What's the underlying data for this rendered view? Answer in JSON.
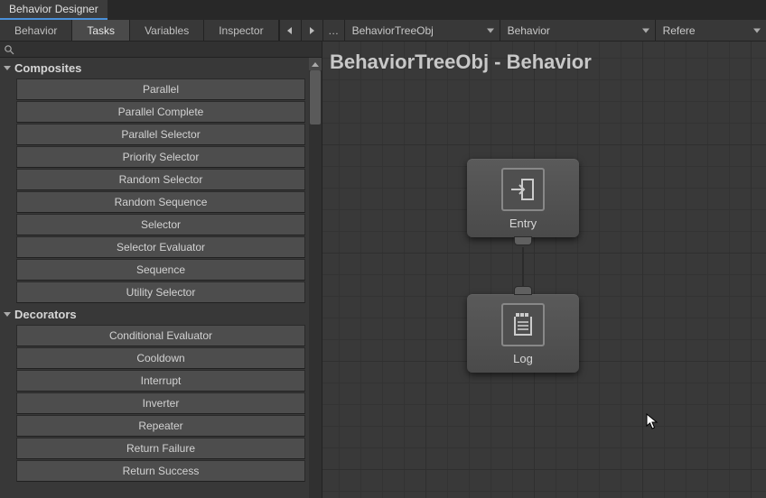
{
  "window_tab": "Behavior Designer",
  "panel_tabs": [
    "Behavior",
    "Tasks",
    "Variables",
    "Inspector"
  ],
  "active_panel_tab": 1,
  "toolbar": {
    "ellipsis": "…",
    "selector_tree": "BehaviorTreeObj",
    "selector_behavior": "Behavior",
    "trailing": "Refere"
  },
  "search": {
    "placeholder": ""
  },
  "categories": [
    {
      "name": "Composites",
      "items": [
        "Parallel",
        "Parallel Complete",
        "Parallel Selector",
        "Priority Selector",
        "Random Selector",
        "Random Sequence",
        "Selector",
        "Selector Evaluator",
        "Sequence",
        "Utility Selector"
      ]
    },
    {
      "name": "Decorators",
      "items": [
        "Conditional Evaluator",
        "Cooldown",
        "Interrupt",
        "Inverter",
        "Repeater",
        "Return Failure",
        "Return Success"
      ]
    }
  ],
  "canvas": {
    "title": "BehaviorTreeObj - Behavior",
    "nodes": [
      {
        "label": "Entry",
        "icon": "entry"
      },
      {
        "label": "Log",
        "icon": "log"
      }
    ]
  }
}
